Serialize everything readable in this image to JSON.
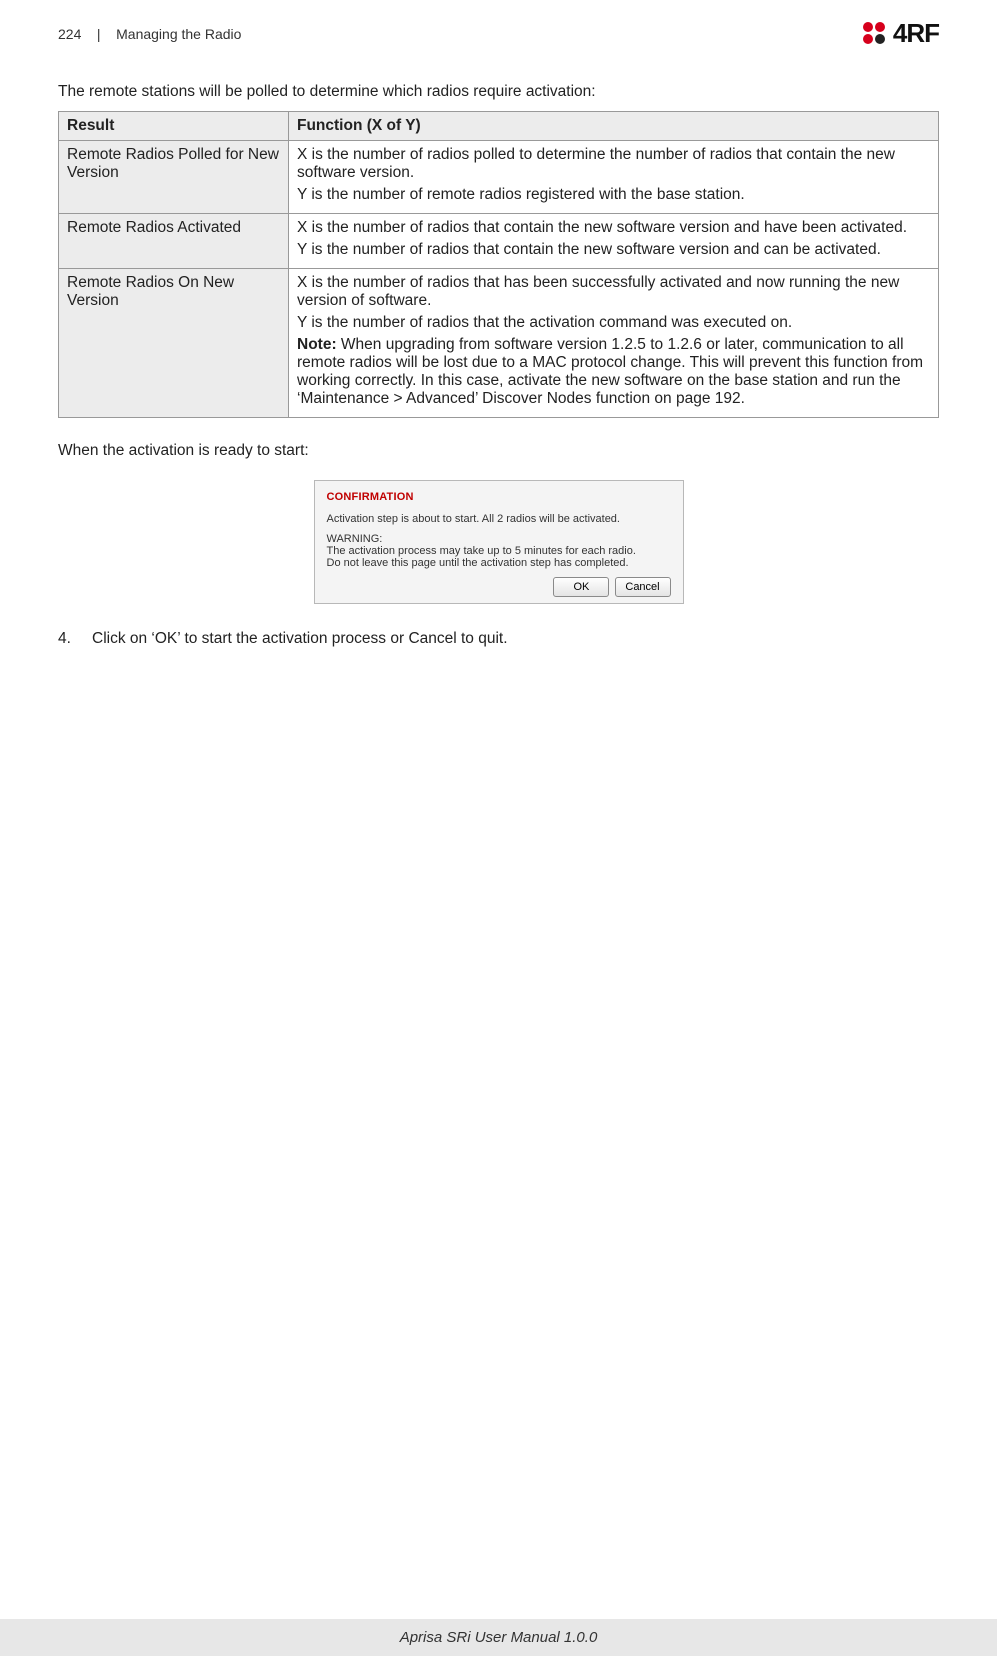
{
  "header": {
    "page_num": "224",
    "section_sep": "|",
    "section": "Managing the Radio",
    "logo_text": "4RF"
  },
  "intro": "The remote stations will be polled to determine which radios require activation:",
  "table": {
    "headers": {
      "col1": "Result",
      "col2": "Function (X of Y)"
    },
    "rows": [
      {
        "result": "Remote Radios Polled for New Version",
        "fn_p1": "X is the number of radios polled to determine the number of radios that contain the new software version.",
        "fn_p2": "Y is the number of remote radios registered with the base station."
      },
      {
        "result": "Remote Radios Activated",
        "fn_p1": "X is the number of radios that contain the new software version and have been activated.",
        "fn_p2": "Y is the number of radios that contain the new software version and can be activated."
      },
      {
        "result": "Remote Radios On New Version",
        "fn_p1": "X is the number of radios that has been successfully activated and now running the new version of software.",
        "fn_p2": "Y is the number of radios that the activation command was executed on.",
        "note_label": "Note:",
        "note_text": " When upgrading from software version 1.2.5 to 1.2.6 or later, communication to all remote radios will be lost due to a MAC protocol change. This will prevent this function from working correctly. In this case, activate the new software on the base station and run the ‘Maintenance > Advanced’ Discover Nodes function on page 192."
      }
    ]
  },
  "after_table": "When the activation is ready to start:",
  "dialog": {
    "title": "CONFIRMATION",
    "line1": "Activation step is about to start. All 2 radios will be activated.",
    "warn_label": "WARNING:",
    "warn1": "The activation process may take up to 5 minutes for each radio.",
    "warn2": "Do not leave this page until the activation step has completed.",
    "ok": "OK",
    "cancel": "Cancel"
  },
  "step4": {
    "num": "4.",
    "text": "Click on ‘OK’ to start the activation process or Cancel to quit."
  },
  "footer": "Aprisa SRi User Manual 1.0.0"
}
